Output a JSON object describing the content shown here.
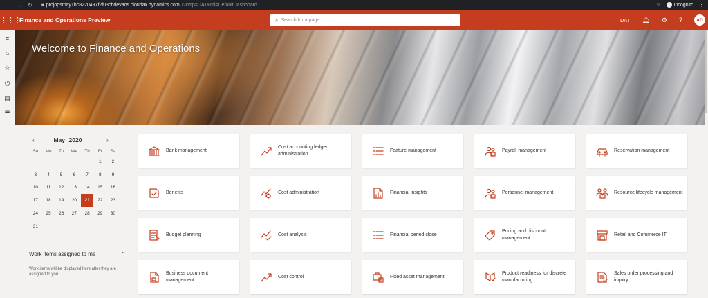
{
  "browser": {
    "url_host": "projopsmay1bc8220497f2f03cbdevaos.cloudax.dynamics.com",
    "url_path": "/?cmp=DAT&mi=DefaultDashboard",
    "incognito_label": "Incognito"
  },
  "header": {
    "app_title": "Finance and Operations Preview",
    "search_placeholder": "Search for a page",
    "company": "DAT",
    "help": "?",
    "avatar_initials": "AD"
  },
  "hero": {
    "title": "Welcome to Finance and Operations"
  },
  "calendar": {
    "prev": "‹",
    "next": "›",
    "month": "May",
    "year": "2020",
    "weekdays": [
      "Su",
      "Mo",
      "Tu",
      "We",
      "Th",
      "Fr",
      "Sa"
    ],
    "weeks": [
      [
        "",
        "",
        "",
        "",
        "",
        "1",
        "2"
      ],
      [
        "3",
        "4",
        "5",
        "6",
        "7",
        "8",
        "9"
      ],
      [
        "10",
        "11",
        "12",
        "13",
        "14",
        "15",
        "16"
      ],
      [
        "17",
        "18",
        "19",
        "20",
        "21",
        "22",
        "23"
      ],
      [
        "24",
        "25",
        "26",
        "27",
        "28",
        "29",
        "30"
      ],
      [
        "31",
        "",
        "",
        "",
        "",
        "",
        ""
      ]
    ],
    "selected_day": "21"
  },
  "work_items": {
    "title": "Work items assigned to me",
    "description": "Work items will be displayed here after they are assigned to you."
  },
  "tiles": [
    [
      "Bank management",
      "Cost accounting ledger administration",
      "Feature management",
      "Payroll management",
      "Reservation management"
    ],
    [
      "Benefits",
      "Cost administration",
      "Financial insights",
      "Personnel management",
      "Resource lifecycle management"
    ],
    [
      "Budget planning",
      "Cost analysis",
      "Financial period close",
      "Pricing and discount management",
      "Retail and Commerce IT"
    ],
    [
      "Business document management",
      "Cost control",
      "Fixed asset management",
      "Product readiness for discrete manufacturing",
      "Sales order processing and inquiry"
    ]
  ],
  "tile_icons": [
    [
      "bank-icon",
      "chart-trend-icon",
      "list-icon",
      "people-icon",
      "car-icon"
    ],
    [
      "benefits-icon",
      "chart-gear-icon",
      "report-icon",
      "people-icon",
      "people-box-icon"
    ],
    [
      "budget-icon",
      "chart-check-icon",
      "list-icon",
      "tag-icon",
      "store-icon"
    ],
    [
      "document-icon",
      "chart-trend-icon",
      "asset-icon",
      "product-icon",
      "order-icon"
    ]
  ],
  "colors": {
    "brand": "#c43d1f",
    "icon": "#c43d1f"
  }
}
